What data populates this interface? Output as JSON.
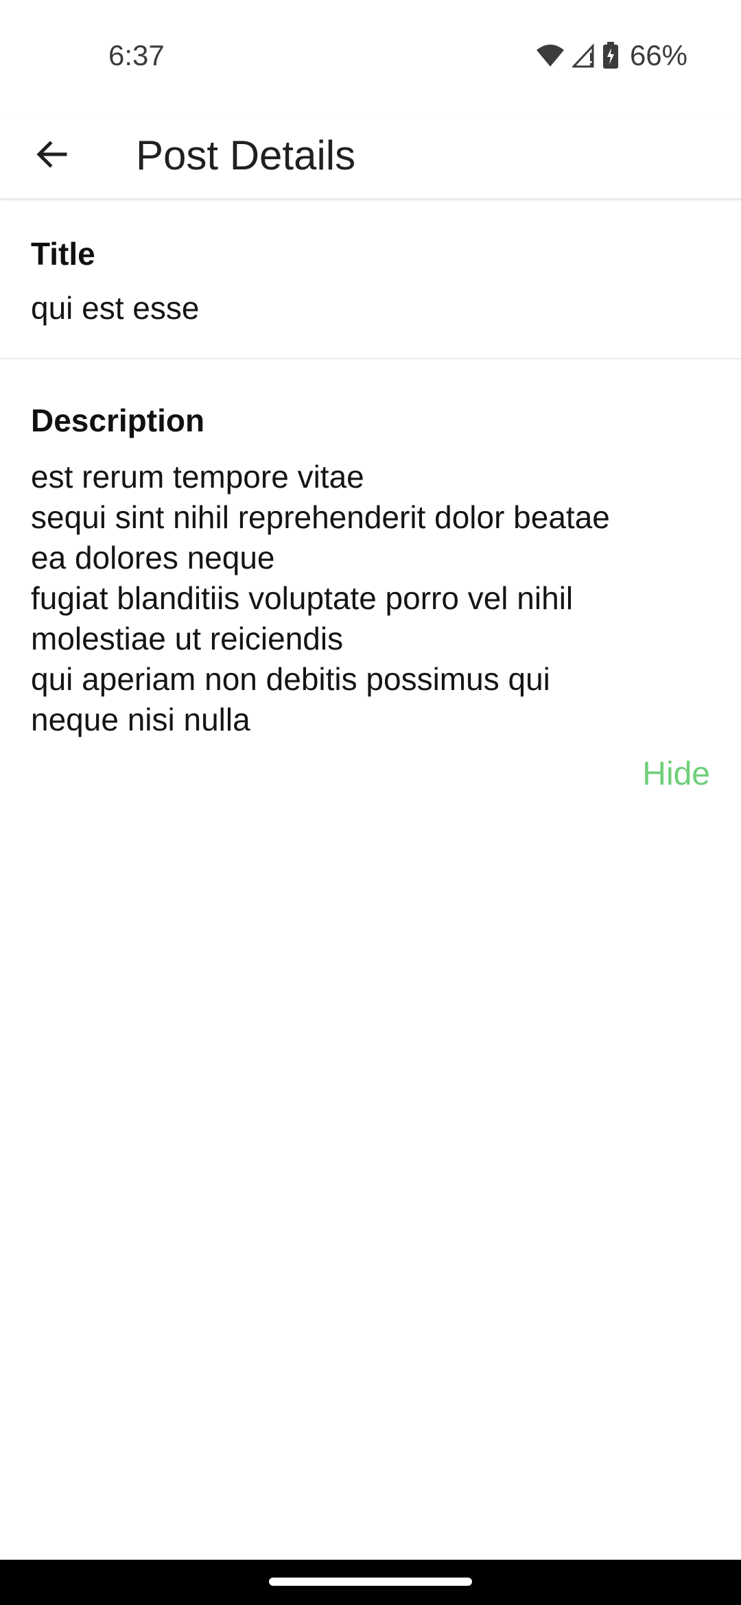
{
  "status_bar": {
    "time": "6:37",
    "battery_percent": "66%",
    "icons": [
      "wifi-icon",
      "signal-icon",
      "battery-charging-icon"
    ]
  },
  "app_bar": {
    "title": "Post Details",
    "back_icon": "arrow-back-icon"
  },
  "post": {
    "title_label": "Title",
    "title_value": "qui est esse",
    "description_label": "Description",
    "description_lines": [
      "est rerum tempore vitae",
      "sequi sint nihil reprehenderit dolor beatae",
      "ea dolores neque",
      "fugiat blanditiis voluptate porro vel nihil",
      "molestiae ut reiciendis",
      "qui aperiam non debitis possimus qui",
      "neque nisi nulla"
    ],
    "toggle_label": "Hide"
  },
  "colors": {
    "accent": "#6fcf7a",
    "text": "#141414",
    "nav_bar": "#000000"
  }
}
